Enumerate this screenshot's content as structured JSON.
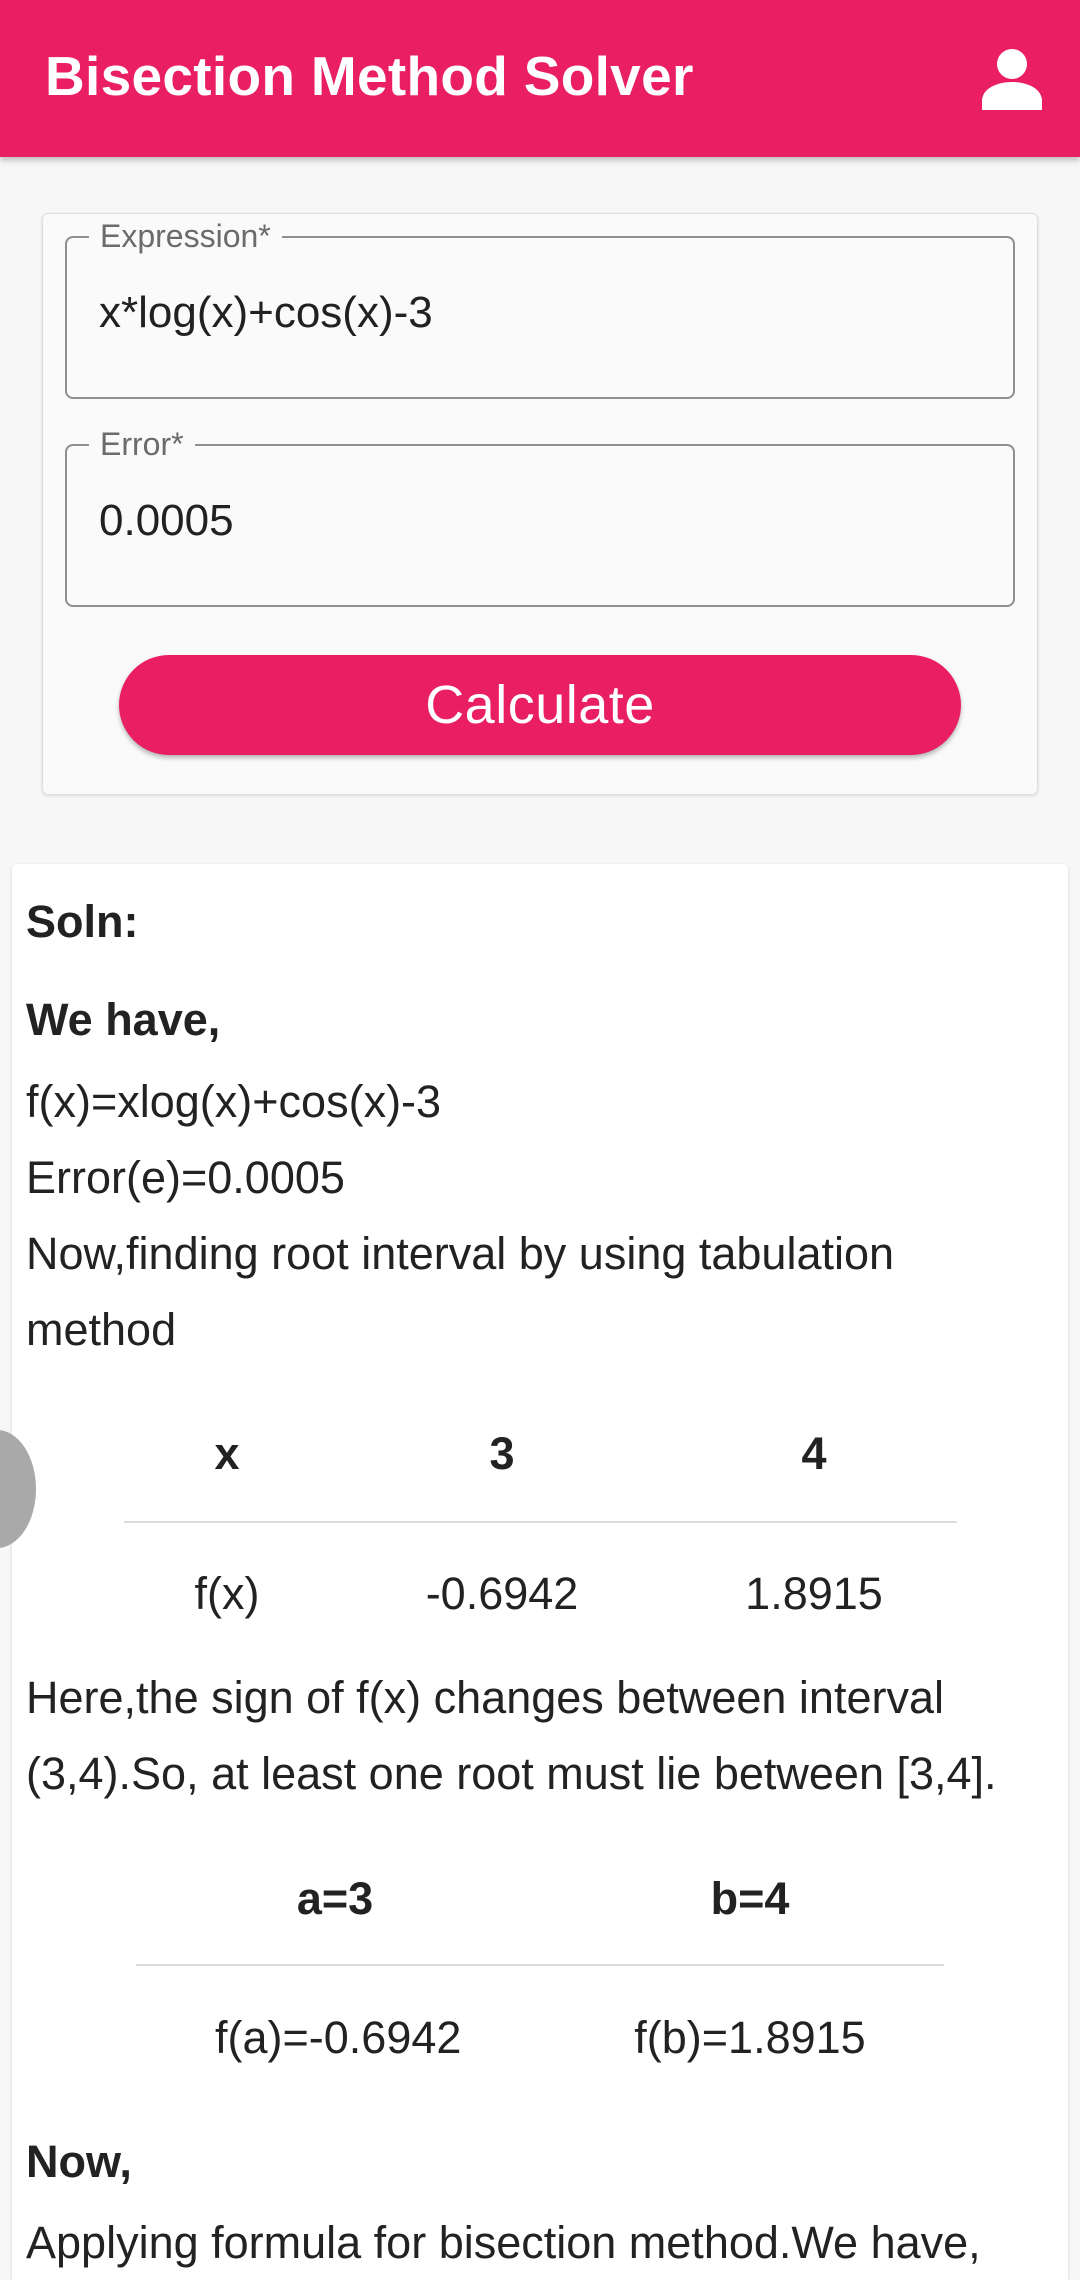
{
  "app_bar": {
    "title": "Bisection Method Solver",
    "account_icon": "account-person-icon"
  },
  "form": {
    "expression": {
      "label": "Expression*",
      "value": "x*log(x)+cos(x)-3"
    },
    "error": {
      "label": "Error*",
      "value": "0.0005"
    },
    "calculate_label": "Calculate"
  },
  "solution": {
    "heading": "Soln:",
    "we_have": "We have,",
    "function_line": "f(x)=xlog(x)+cos(x)-3",
    "error_line": "Error(e)=0.0005",
    "tabulation_line1": "Now,finding root interval by using tabulation",
    "tabulation_line2": "method",
    "tabulation": {
      "header": [
        "x",
        "3",
        "4"
      ],
      "row": [
        "f(x)",
        "-0.6942",
        "1.8915"
      ]
    },
    "sign_change_line1": "Here,the sign of f(x) changes between interval",
    "sign_change_line2": "(3,4).So, at least one root must lie between [3,4].",
    "interval": {
      "header": [
        "a=3",
        "b=4"
      ],
      "row": [
        "f(a)=-0.6942",
        "f(b)=1.8915"
      ]
    },
    "now_heading": "Now,",
    "formula_line": "Applying formula for bisection method.We have,"
  },
  "colors": {
    "primary": "#e91e63",
    "background": "#f7f7f7",
    "card": "#ffffff"
  }
}
